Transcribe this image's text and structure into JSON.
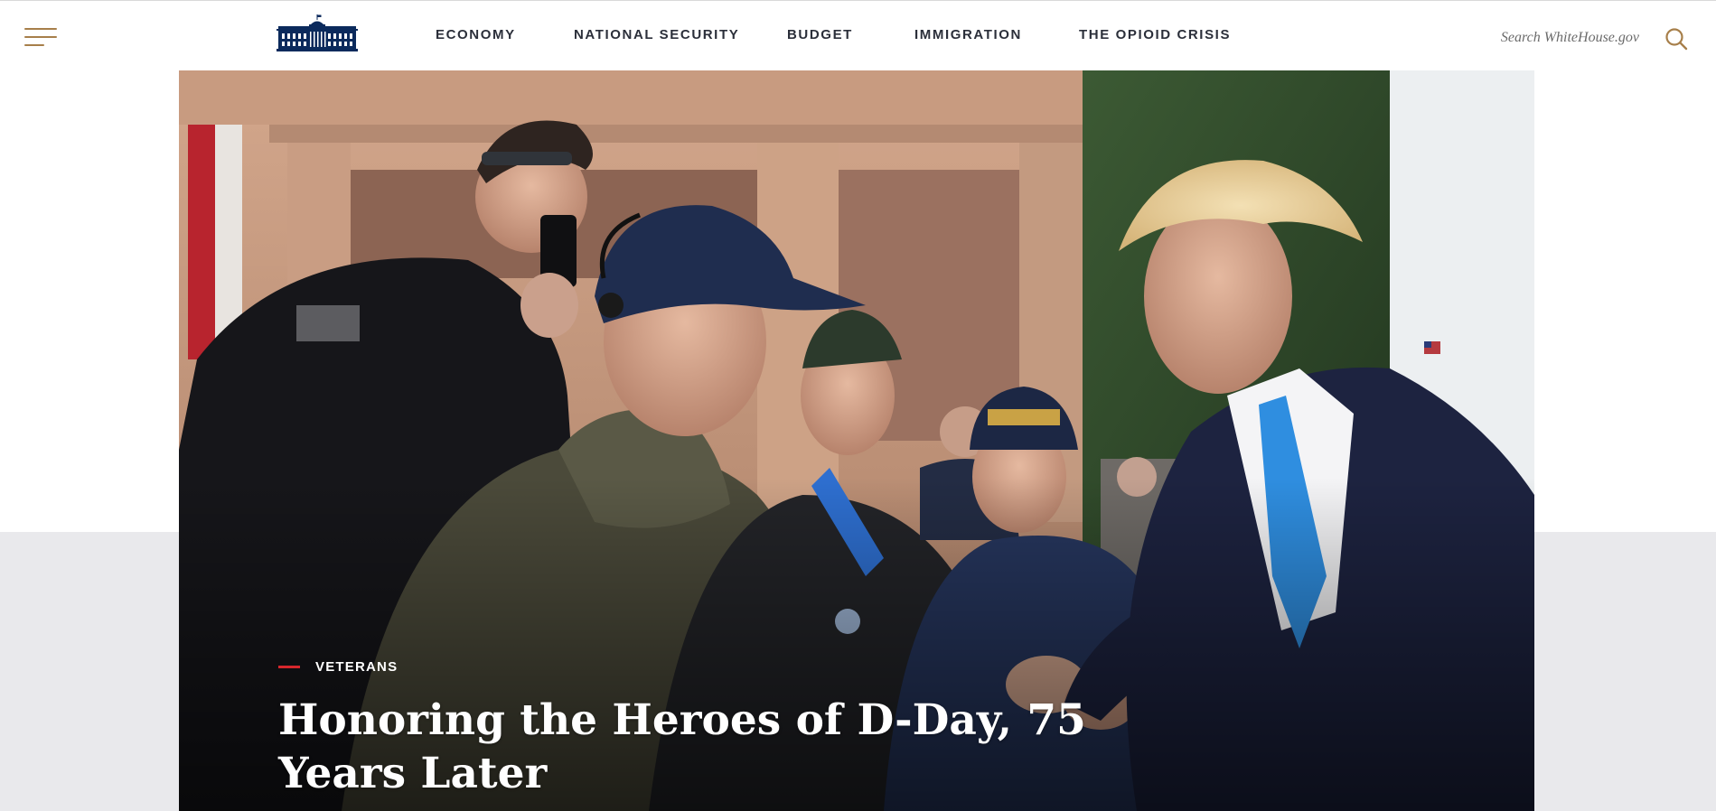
{
  "header": {
    "logo_alt": "The White House",
    "nav": [
      {
        "label": "ECONOMY"
      },
      {
        "label": "NATIONAL SECURITY"
      },
      {
        "label": "BUDGET"
      },
      {
        "label": "IMMIGRATION"
      },
      {
        "label": "THE OPIOID CRISIS"
      }
    ],
    "search": {
      "placeholder": "Search WhiteHouse.gov"
    }
  },
  "hero": {
    "category": "VETERANS",
    "title": "Honoring the Heroes of D-Day, 75 Years Later"
  },
  "colors": {
    "accent_gold": "#a77f4a",
    "nav_text": "#2b2f3a",
    "category_dash": "#d6262c",
    "grey_band": "#e9e9ec"
  },
  "icons": {
    "menu": "hamburger-menu-icon",
    "logo": "white-house-logo-icon",
    "search": "search-icon"
  }
}
